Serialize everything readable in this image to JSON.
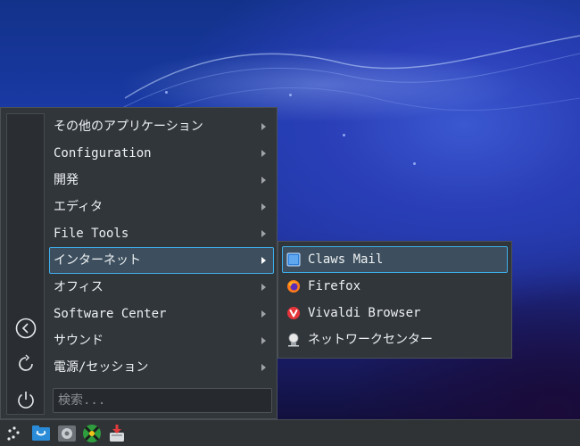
{
  "menu": {
    "items": [
      {
        "label": "その他のアプリケーション"
      },
      {
        "label": "Configuration"
      },
      {
        "label": "開発"
      },
      {
        "label": "エディタ"
      },
      {
        "label": "File Tools"
      },
      {
        "label": "インターネット"
      },
      {
        "label": "オフィス"
      },
      {
        "label": "Software Center"
      },
      {
        "label": "サウンド"
      },
      {
        "label": "電源/セッション"
      }
    ],
    "active_item": "インターネット",
    "search_placeholder": "検索..."
  },
  "side_buttons": [
    "back-icon",
    "refresh-icon",
    "power-icon"
  ],
  "submenu": {
    "items": [
      {
        "label": "Claws Mail",
        "icon": "claws-mail-icon"
      },
      {
        "label": "Firefox",
        "icon": "firefox-icon"
      },
      {
        "label": "Vivaldi Browser",
        "icon": "vivaldi-icon"
      },
      {
        "label": "ネットワークセンター",
        "icon": "network-center-icon"
      }
    ],
    "active_item": "Claws Mail"
  },
  "taskbar": {
    "icons": [
      "start-menu-icon",
      "file-manager-icon",
      "settings-icon",
      "network-icon",
      "download-icon"
    ]
  },
  "colors": {
    "accent": "#3daee9",
    "menu_bg": "#31363b",
    "taskbar_bg": "#2f3336"
  }
}
